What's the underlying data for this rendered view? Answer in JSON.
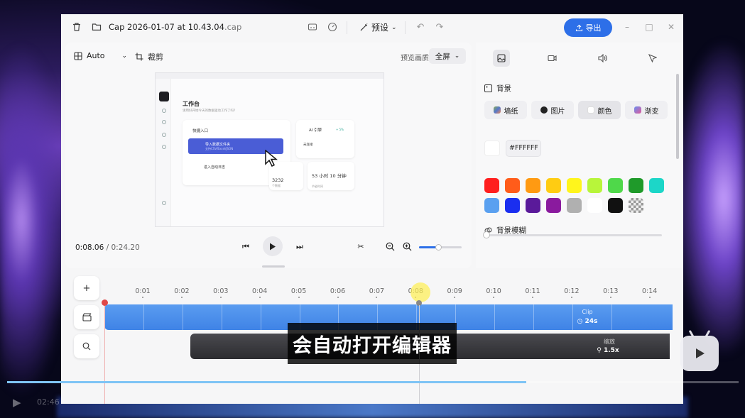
{
  "titlebar": {
    "filename": "Cap 2026-01-07 at 10.43.04",
    "ext": ".cap",
    "preset_label": "预设",
    "export_label": "导出"
  },
  "editor": {
    "aspect_label": "Auto",
    "crop_label": "裁剪",
    "preview_quality_label": "预览画质",
    "preview_quality_value": "全屏",
    "time_current": "0:08.06",
    "time_separator": " / ",
    "time_total": "0:24.20",
    "zoom_level": 0.45
  },
  "preview": {
    "title": "工作台",
    "subtitle": "请用好开始今天的数据驱动工作了吗?",
    "quick_entry": "快捷入口",
    "import_label": "导入数据文件夹",
    "import_sub": "支持CSV/Excel/JSON",
    "auto_label": "进入自动日志",
    "ai_label": "AI 引擎",
    "ai_badge": "+ 5%",
    "ai_connected": "未连接",
    "stat1_value": "3232",
    "stat1_label": "个数据",
    "stat2_value": "53 小时 10 分钟",
    "stat2_label": "节省时间"
  },
  "panel": {
    "background_title": "背景",
    "tabs": [
      "墙纸",
      "图片",
      "颜色",
      "渐变"
    ],
    "active_tab": "颜色",
    "hex_value": "#FFFFFF",
    "colors": [
      "#ff1e1e",
      "#ff5c1a",
      "#ff9a12",
      "#ffcc12",
      "#fff51c",
      "#b8f53a",
      "#4fd84a",
      "#1f9a2a",
      "#1cd6c8",
      "#5aa0f0",
      "#1a2ef0",
      "#5a1a9a",
      "#8a1a9e",
      "#b0b0b0",
      "#ffffff",
      "#111111",
      "transparent"
    ],
    "blur_title": "背景模糊",
    "blur_level": 0
  },
  "timeline": {
    "ticks": [
      "0:01",
      "0:02",
      "0:03",
      "0:04",
      "0:05",
      "0:06",
      "0:07",
      "0:08",
      "0:09",
      "0:10",
      "0:11",
      "0:12",
      "0:13",
      "0:14"
    ],
    "clip_label": "Clip",
    "clip_duration": "24s",
    "zoom_label": "缩放",
    "zoom_value": "1.5x"
  },
  "overlay": {
    "subtitle": "会自动打开编辑器",
    "player_time": "02:46",
    "progress": 0.71
  },
  "accent": "#2d6fe8"
}
